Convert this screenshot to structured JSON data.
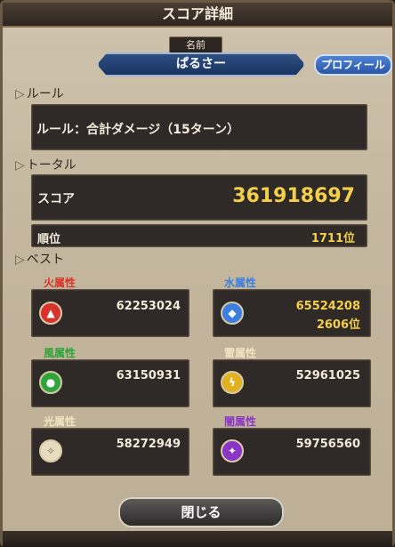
{
  "dialog": {
    "title": "スコア詳細"
  },
  "player": {
    "name_tag": "名前",
    "name": "ぱるさー",
    "profile_button": "プロフィール"
  },
  "rule": {
    "heading": "ルール",
    "text": "ルール：合計ダメージ（15ターン）"
  },
  "total": {
    "heading": "トータル",
    "score_label": "スコア",
    "score_value": "361918697",
    "rank_label": "順位",
    "rank_value": "1711位"
  },
  "best": {
    "heading": "ベスト",
    "attributes": [
      {
        "label": "火属性",
        "value": "62253024",
        "rank": "",
        "color": "#d8332a",
        "icon_name": "fire-element-icon"
      },
      {
        "label": "水属性",
        "value": "65524208",
        "rank": "2606位",
        "color": "#3d7fe0",
        "icon_name": "water-element-icon"
      },
      {
        "label": "風属性",
        "value": "63150931",
        "rank": "",
        "color": "#2fa43a",
        "icon_name": "wind-element-icon"
      },
      {
        "label": "雷属性",
        "value": "52961025",
        "rank": "",
        "color": "#e0b21f",
        "icon_name": "lightning-element-icon"
      },
      {
        "label": "光属性",
        "value": "58272949",
        "rank": "",
        "color": "#e8dcc0",
        "icon_name": "light-element-icon"
      },
      {
        "label": "闇属性",
        "value": "59756560",
        "rank": "",
        "color": "#8a35c6",
        "icon_name": "dark-element-icon"
      }
    ]
  },
  "footer": {
    "close_button": "閉じる"
  },
  "colors": {
    "accent_gold": "#f3cf4a",
    "panel_dark": "#2f2a27"
  }
}
